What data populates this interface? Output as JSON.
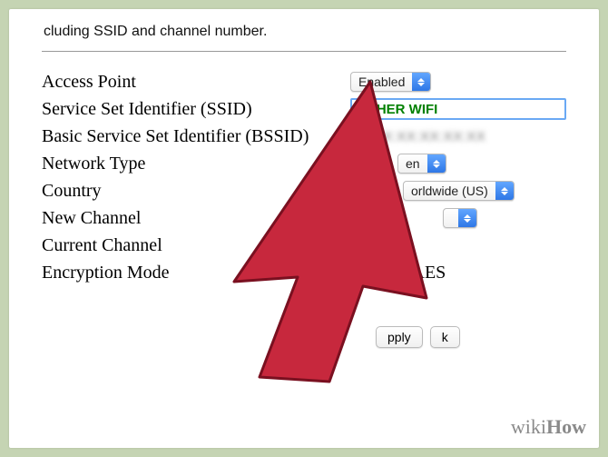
{
  "header": {
    "fragment": "cluding SSID and channel number."
  },
  "labels": {
    "access_point": "Access Point",
    "ssid": "Service Set Identifier (SSID)",
    "bssid": "Basic Service Set Identifier (BSSID)",
    "network_type": "Network Type",
    "country": "Country",
    "new_channel": "New Channel",
    "current_channel": "Current Channel",
    "encryption_mode": "Encryption Mode"
  },
  "values": {
    "access_point": "Enabled",
    "ssid_input": "OTHER WIFI",
    "bssid": "",
    "network_type": "en",
    "country": "orldwide (US)",
    "new_channel": "",
    "current_channel": "",
    "encryption_mode": "KIP+AES"
  },
  "buttons": {
    "left_partial": "pply",
    "right_partial": "k"
  },
  "watermark": {
    "part1": "wiki",
    "part2": "How"
  }
}
